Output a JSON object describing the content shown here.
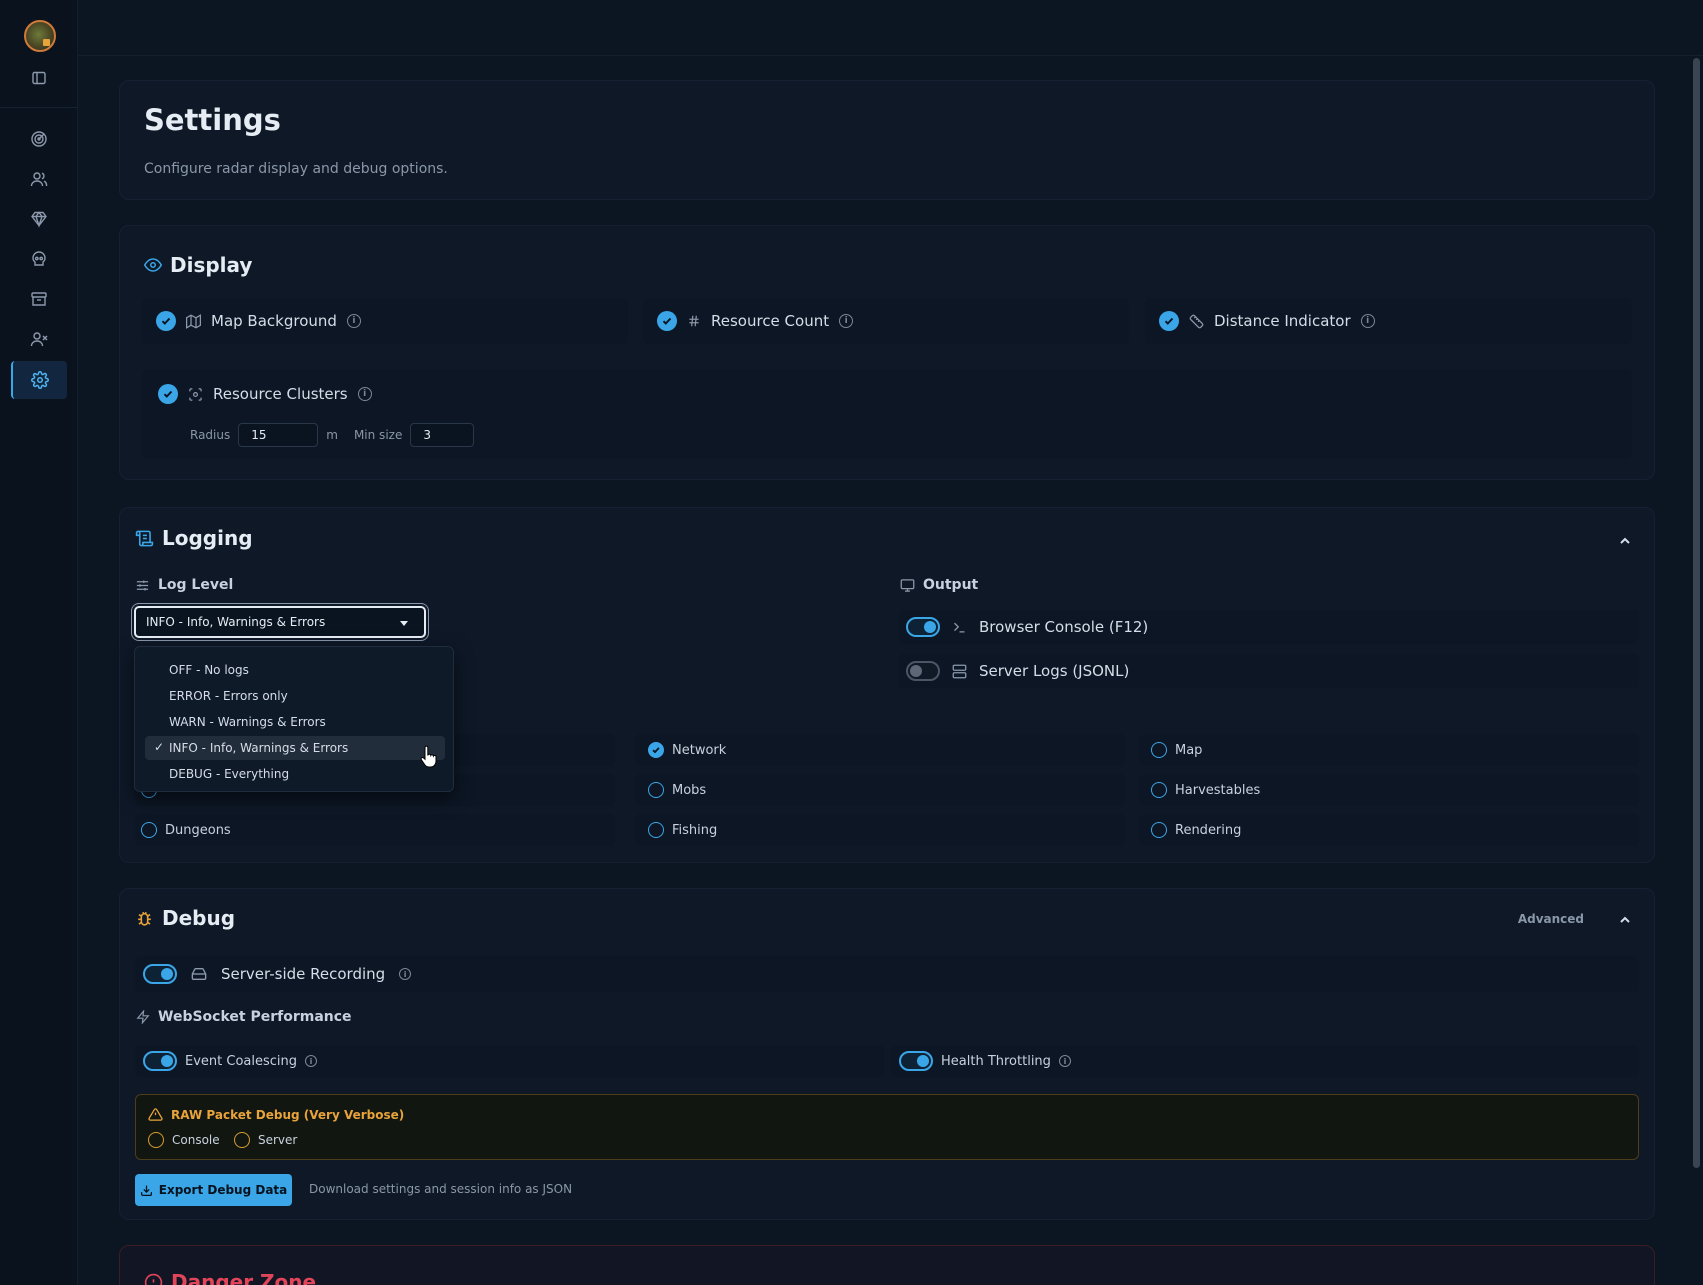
{
  "settings_header": {
    "title": "Settings",
    "subtitle": "Configure radar display and debug options."
  },
  "display": {
    "title": "Display",
    "options": [
      {
        "label": "Map Background",
        "checked": true,
        "icon": "map-icon"
      },
      {
        "label": "Resource Count",
        "checked": true,
        "icon": "hash-icon"
      },
      {
        "label": "Distance Indicator",
        "checked": true,
        "icon": "ruler-icon"
      }
    ],
    "clusters": {
      "label": "Resource Clusters",
      "checked": true,
      "radius_label": "Radius",
      "radius_value": "15",
      "radius_unit": "m",
      "min_size_label": "Min size",
      "min_size_value": "3"
    }
  },
  "logging": {
    "title": "Logging",
    "log_level_label": "Log Level",
    "selected_level": "INFO - Info, Warnings & Errors",
    "level_options": [
      "OFF - No logs",
      "ERROR - Errors only",
      "WARN - Warnings & Errors",
      "INFO - Info, Warnings & Errors",
      "DEBUG - Everything"
    ],
    "output_label": "Output",
    "outputs": [
      {
        "label": "Browser Console (F12)",
        "enabled": true
      },
      {
        "label": "Server Logs (JSONL)",
        "enabled": false
      }
    ],
    "categories": [
      {
        "label": "Network",
        "checked": true
      },
      {
        "label": "Map",
        "checked": false
      },
      {
        "label": "Mobs",
        "checked": false
      },
      {
        "label": "Harvestables",
        "checked": false
      },
      {
        "label": "Dungeons",
        "checked": false
      },
      {
        "label": "Fishing",
        "checked": false
      },
      {
        "label": "Rendering",
        "checked": false
      }
    ]
  },
  "debug": {
    "title": "Debug",
    "advanced_label": "Advanced",
    "server_recording_label": "Server-side Recording",
    "server_recording_enabled": true,
    "ws_perf_label": "WebSocket Performance",
    "event_coalescing_label": "Event Coalescing",
    "event_coalescing_enabled": true,
    "health_throttling_label": "Health Throttling",
    "health_throttling_enabled": true,
    "raw_packet_title": "RAW Packet Debug (Very Verbose)",
    "raw_console_label": "Console",
    "raw_server_label": "Server",
    "export_label": "Export Debug Data",
    "export_hint": "Download settings and session info as JSON"
  },
  "danger": {
    "title": "Danger Zone"
  },
  "colors": {
    "accent": "#3aa6e8",
    "warning": "#e8a33a",
    "danger": "#e2455a",
    "background": "#0c1522"
  }
}
